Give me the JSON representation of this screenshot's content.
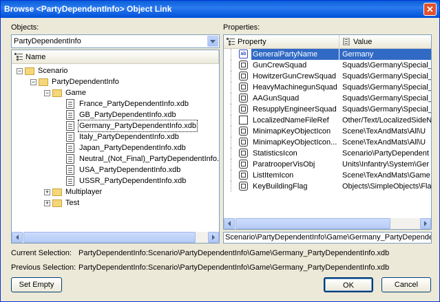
{
  "window": {
    "title": "Browse <PartyDependentInfo> Object Link",
    "close_glyph": "✕"
  },
  "objects": {
    "label": "Objects:",
    "combo_value": "PartyDependentInfo",
    "column_name": "Name",
    "tree": [
      {
        "label": "Scenario",
        "type": "folder",
        "level": 0,
        "expander": "−"
      },
      {
        "label": "PartyDependentInfo",
        "type": "folder",
        "level": 1,
        "expander": "−"
      },
      {
        "label": "Game",
        "type": "folder",
        "level": 2,
        "expander": "−"
      },
      {
        "label": "France_PartyDependentInfo.xdb",
        "type": "doc",
        "level": 3
      },
      {
        "label": "GB_PartyDependentInfo.xdb",
        "type": "doc",
        "level": 3
      },
      {
        "label": "Germany_PartyDependentInfo.xdb",
        "type": "doc",
        "level": 3,
        "selected": true
      },
      {
        "label": "Italy_PartyDependentInfo.xdb",
        "type": "doc",
        "level": 3
      },
      {
        "label": "Japan_PartyDependentInfo.xdb",
        "type": "doc",
        "level": 3
      },
      {
        "label": "Neutral_(Not_Final)_PartyDependentInfo.xdb",
        "type": "doc",
        "level": 3
      },
      {
        "label": "USA_PartyDependentInfo.xdb",
        "type": "doc",
        "level": 3
      },
      {
        "label": "USSR_PartyDependentInfo.xdb",
        "type": "doc",
        "level": 3
      },
      {
        "label": "Multiplayer",
        "type": "folder",
        "level": 2,
        "expander": "+"
      },
      {
        "label": "Test",
        "type": "folder",
        "level": 2,
        "expander": "+"
      }
    ]
  },
  "properties": {
    "label": "Properties:",
    "column_property": "Property",
    "column_value": "Value",
    "rows": [
      {
        "name": "GeneralPartyName",
        "value": "Germany",
        "icon": "ab-icon",
        "selected": true
      },
      {
        "name": "GunCrewSquad",
        "value": "Squads\\Germany\\Special_",
        "icon": "link-icon"
      },
      {
        "name": "HowitzerGunCrewSquad",
        "value": "Squads\\Germany\\Special_",
        "icon": "link-icon"
      },
      {
        "name": "HeavyMachinegunSquad",
        "value": "Squads\\Germany\\Special_",
        "icon": "link-icon"
      },
      {
        "name": "AAGunSquad",
        "value": "Squads\\Germany\\Special_",
        "icon": "link-icon"
      },
      {
        "name": "ResupplyEngineerSquad",
        "value": "Squads\\Germany\\Special_",
        "icon": "link-icon"
      },
      {
        "name": "LocalizedNameFileRef",
        "value": "Other/Text/LocalizedSideN",
        "icon": "file-icon"
      },
      {
        "name": "MinimapKeyObjectIcon",
        "value": "Scene\\TexAndMats\\All\\U",
        "icon": "link-icon"
      },
      {
        "name": "MinimapKeyObjectIcon...",
        "value": "Scene\\TexAndMats\\All\\U",
        "icon": "link-icon"
      },
      {
        "name": "StatisticsIcon",
        "value": "Scenario\\PartyDependent",
        "icon": "link-icon"
      },
      {
        "name": "ParatrooperVisObj",
        "value": "Units\\Infantry\\System\\Ger",
        "icon": "link-icon"
      },
      {
        "name": "ListItemIcon",
        "value": "Scene\\TexAndMats\\Game",
        "icon": "link-icon"
      },
      {
        "name": "KeyBuildingFlag",
        "value": "Objects\\SimpleObjects\\Fla",
        "icon": "link-icon"
      }
    ],
    "path_field": "Scenario\\PartyDependentInfo\\Game\\Germany_PartyDependen"
  },
  "selection": {
    "current_label": "Current Selection:",
    "current_value": "PartyDependentInfo:Scenario\\PartyDependentInfo\\Game\\Germany_PartyDependentInfo.xdb",
    "previous_label": "Previous Selection:",
    "previous_value": "PartyDependentInfo:Scenario\\PartyDependentInfo\\Game\\Germany_PartyDependentInfo.xdb"
  },
  "buttons": {
    "set_empty": "Set Empty",
    "ok": "OK",
    "cancel": "Cancel"
  },
  "colors": {
    "titlebar": "#0a5fd8",
    "selection": "#316ac5",
    "dialog_bg": "#ece9d8"
  }
}
